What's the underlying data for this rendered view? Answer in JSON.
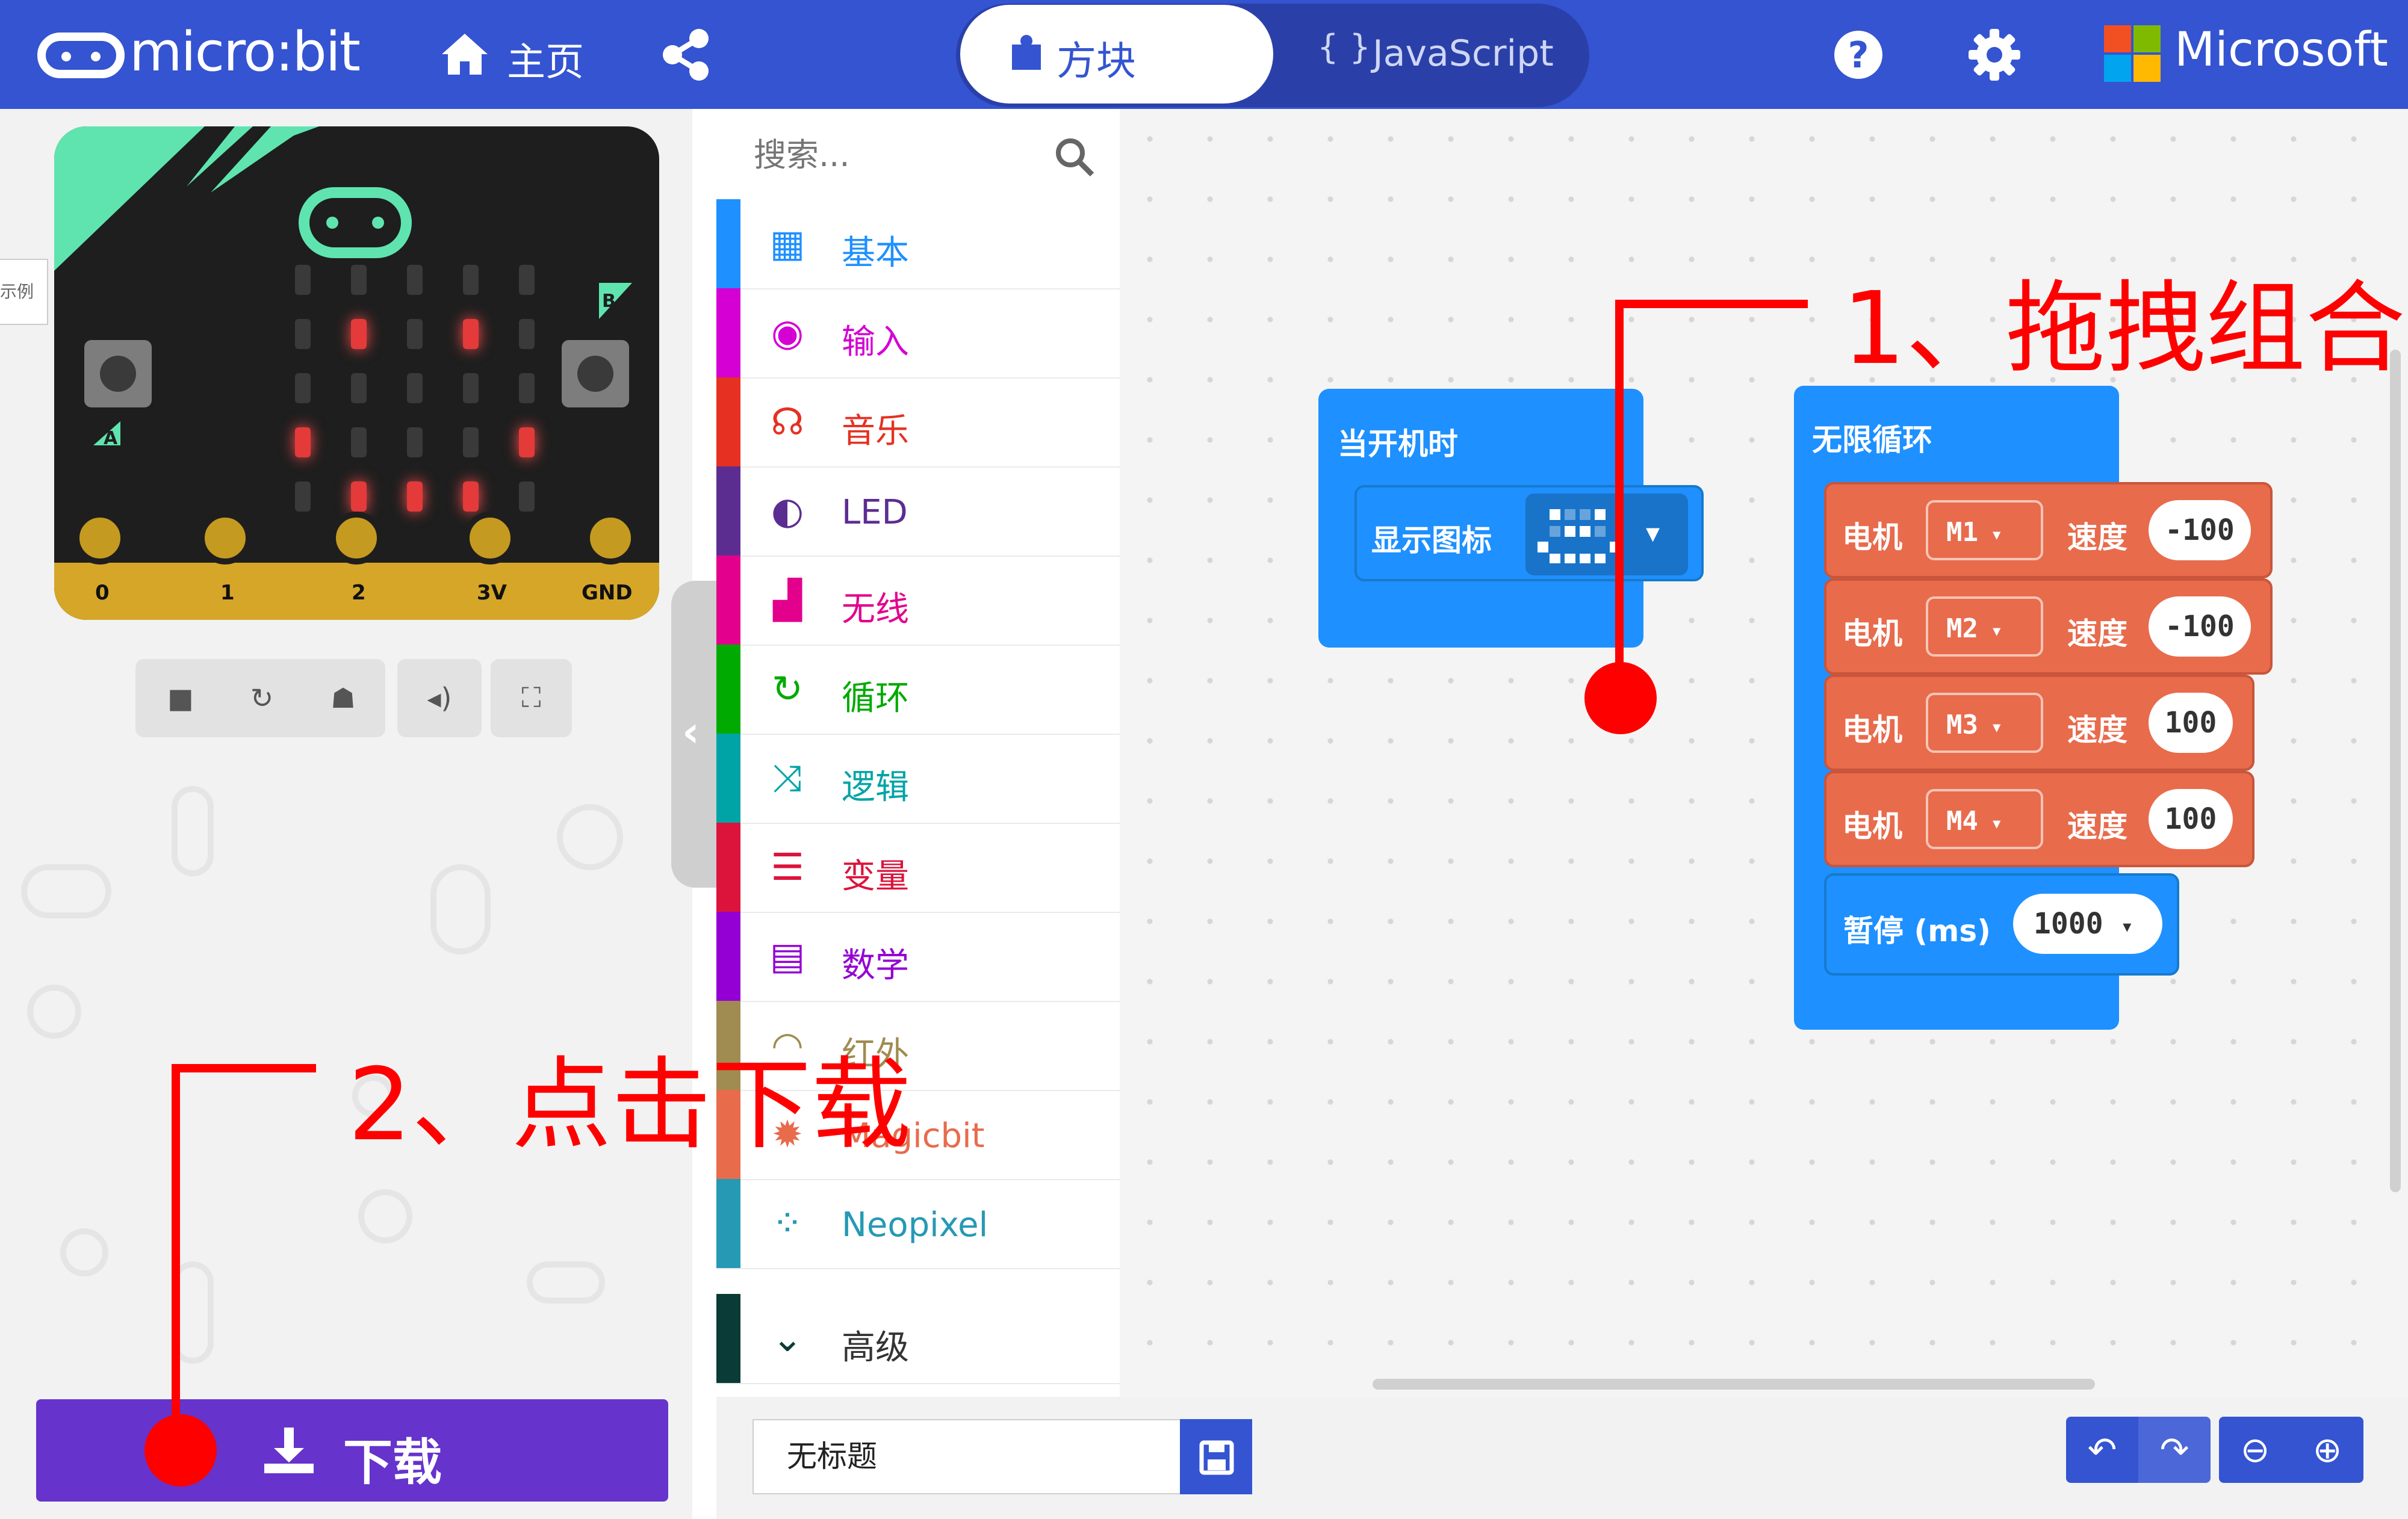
{
  "header": {
    "brand": "micro:bit",
    "home_label": "主页",
    "tabs": [
      {
        "label": "方块",
        "active": true
      },
      {
        "label": "JavaScript",
        "active": false
      }
    ],
    "microsoft_label": "Microsoft",
    "icons": [
      "home-icon",
      "share-icon",
      "help-icon",
      "gear-icon"
    ]
  },
  "simulator": {
    "pins": [
      "0",
      "1",
      "2",
      "3V",
      "GND"
    ],
    "button_a": "A",
    "button_b": "B",
    "led_matrix": [
      [
        0,
        0,
        0,
        0,
        0
      ],
      [
        0,
        1,
        0,
        1,
        0
      ],
      [
        0,
        0,
        0,
        0,
        0
      ],
      [
        1,
        0,
        0,
        0,
        1
      ],
      [
        0,
        1,
        1,
        1,
        0
      ]
    ],
    "controls": [
      "stop-icon",
      "restart-icon",
      "debug-icon",
      "mute-icon",
      "fullscreen-icon"
    ],
    "side_tab": "示例"
  },
  "toolbox": {
    "search_placeholder": "搜索...",
    "categories": [
      {
        "label": "基本",
        "color": "#1e90ff",
        "icon": "grid-icon"
      },
      {
        "label": "输入",
        "color": "#d400d4",
        "icon": "target-icon"
      },
      {
        "label": "音乐",
        "color": "#e63022",
        "icon": "headphones-icon"
      },
      {
        "label": "LED",
        "color": "#5c2d91",
        "icon": "toggle-icon"
      },
      {
        "label": "无线",
        "color": "#e3008c",
        "icon": "signal-icon"
      },
      {
        "label": "循环",
        "color": "#00aa00",
        "icon": "loop-icon"
      },
      {
        "label": "逻辑",
        "color": "#00a4a6",
        "icon": "shuffle-icon"
      },
      {
        "label": "变量",
        "color": "#dc143c",
        "icon": "lines-icon"
      },
      {
        "label": "数学",
        "color": "#9400d3",
        "icon": "calculator-icon"
      },
      {
        "label": "红外",
        "color": "#a08c50",
        "icon": "wifi-icon"
      },
      {
        "label": "Magicbit",
        "color": "#e86b4c",
        "icon": "gear-icon"
      },
      {
        "label": "Neopixel",
        "color": "#2699b4",
        "icon": "dotted-circle-icon"
      },
      {
        "label": "高级",
        "color": "#0b3b36",
        "icon": "chevron-down-icon"
      }
    ]
  },
  "workspace": {
    "on_start": {
      "label": "当开机时",
      "show_icon_label": "显示图标"
    },
    "forever": {
      "label": "无限循环",
      "motor_label": "电机",
      "speed_label": "速度",
      "motors": [
        {
          "motor": "M1",
          "speed": "-100"
        },
        {
          "motor": "M2",
          "speed": "-100"
        },
        {
          "motor": "M3",
          "speed": "100"
        },
        {
          "motor": "M4",
          "speed": "100"
        }
      ],
      "pause_label": "暂停 (ms)",
      "pause_value": "1000"
    }
  },
  "bottom": {
    "download_label": "下载",
    "project_name": "无标题",
    "icons": [
      "undo-icon",
      "redo-icon",
      "zoom-out-icon",
      "zoom-in-icon"
    ]
  },
  "annotations": {
    "step1": "1、拖拽组合",
    "step2": "2、点击下载"
  },
  "colors": {
    "header_blue": "#3454d1",
    "download_purple": "#6633cc",
    "block_blue": "#1e90ff",
    "block_orange": "#e86b4c",
    "annotation_red": "#ff0000"
  }
}
